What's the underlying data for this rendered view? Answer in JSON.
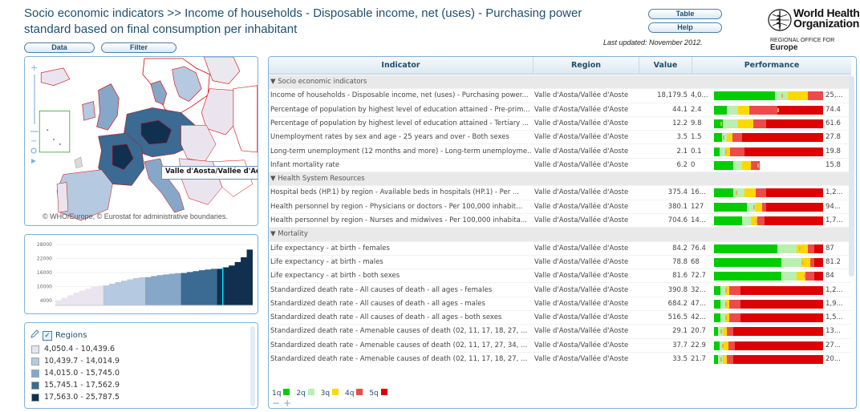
{
  "header": {
    "title": "Socio economic indicators >> Income of households - Disposable income, net (uses) - Purchasing power standard based on final consumption per inhabitant",
    "data_button": "Data",
    "filter_button": "Filter",
    "table_button": "Table",
    "help_button": "Help",
    "last_updated": "Last updated: November 2012."
  },
  "logo": {
    "line1": "World Health",
    "line2": "Organization",
    "regional_small": "REGIONAL OFFICE FOR",
    "regional_big": "Europe"
  },
  "map": {
    "callout": "Valle d'Aosta/Vallée d'Aos",
    "copyright": "© WHO/Europe, © Eurostat for administrative boundaries.",
    "zoom_plus": "+",
    "zoom_minus": "−"
  },
  "chart_data": {
    "type": "area",
    "yticks": [
      4000,
      10000,
      16000,
      22000,
      28000
    ],
    "ylim": [
      2000,
      30000
    ],
    "classes": [
      {
        "range": "4,050.4 - 10,439.6",
        "values": [
          4050,
          5200,
          6300,
          7400,
          8300,
          9100,
          9900,
          10400
        ],
        "color": "#eae4ef"
      },
      {
        "range": "10,439.7 - 14,014.9",
        "values": [
          10500,
          11200,
          11900,
          12500,
          13100,
          13600,
          14000
        ],
        "color": "#b5c9e0"
      },
      {
        "range": "14,015.0 - 15,745.0",
        "values": [
          14050,
          14500,
          14900,
          15200,
          15500,
          15700
        ],
        "color": "#86a7c8"
      },
      {
        "range": "15,745.1 - 17,562.9",
        "values": [
          15800,
          16200,
          16600,
          17000,
          17300,
          17560
        ],
        "color": "#3b6a93"
      },
      {
        "range": "17,563.0 - 25,787.5",
        "values": [
          17600,
          18200,
          19000,
          20500,
          22500,
          25788
        ],
        "color": "#10304f"
      }
    ],
    "highlight_value": 18179.5
  },
  "legend": {
    "title": "Regions",
    "items": [
      {
        "label": "4,050.4 - 10,439.6",
        "color": "#eae4ef"
      },
      {
        "label": "10,439.7 - 14,014.9",
        "color": "#b5c9e0"
      },
      {
        "label": "14,015.0 - 15,745.0",
        "color": "#86a7c8"
      },
      {
        "label": "15,745.1 - 17,562.9",
        "color": "#3b6a93"
      },
      {
        "label": "17,563.0 - 25,787.5",
        "color": "#10304f"
      }
    ]
  },
  "table": {
    "headers": {
      "indicator": "Indicator",
      "region": "Region",
      "value": "Value",
      "performance": "Performance"
    },
    "rows": [
      {
        "group": true,
        "label": "▼ Socio economic indicators"
      },
      {
        "indicator": "Income of households - Disposable income, net (uses) - Purchasing power...",
        "region": "Valle d'Aosta/Vallée d'Aoste",
        "value": "18,179.5",
        "min": "4,0...",
        "max": "25,...",
        "bar": [
          0.56,
          0.68,
          0.86,
          1.0,
          1.0
        ],
        "marker": 0.62
      },
      {
        "indicator": "Percentage of population by highest level of education attained - Pre-prim...",
        "region": "Valle d'Aosta/Vallée d'Aoste",
        "value": "44.1",
        "min": "2.4",
        "max": "74.4",
        "bar": [
          0.12,
          0.22,
          0.32,
          0.58,
          1.0
        ],
        "marker": 0.58
      },
      {
        "indicator": "Percentage of population by highest level of education attained - Tertiary ...",
        "region": "Valle d'Aosta/Vallée d'Aoste",
        "value": "12.2",
        "min": "9.8",
        "max": "61.6",
        "bar": [
          0.08,
          0.22,
          0.36,
          0.48,
          1.0
        ],
        "marker": 0.06
      },
      {
        "indicator": "Unemployment rates by sex and age - 25 years and over - Both sexes",
        "region": "Valle d'Aosta/Vallée d'Aoste",
        "value": "3.5",
        "min": "1.5",
        "max": "27.8",
        "bar": [
          0.07,
          0.12,
          0.17,
          0.26,
          1.0
        ],
        "marker": 0.08
      },
      {
        "indicator": "Long-term unemployment (12 months and more) - Long-term unemployme...",
        "region": "Valle d'Aosta/Vallée d'Aoste",
        "value": "2.1",
        "min": "0.1",
        "max": "19.8",
        "bar": [
          0.05,
          0.1,
          0.15,
          0.28,
          1.0
        ],
        "marker": 0.1
      },
      {
        "indicator": "Infant mortality rate",
        "region": "Valle d'Aosta/Vallée d'Aoste",
        "value": "6.2",
        "min": "0",
        "max": "15.8",
        "bar": [
          0.18,
          0.26,
          0.34,
          0.42,
          0.42
        ],
        "marker": 0.4
      },
      {
        "group": true,
        "label": "▼ Health System Resources"
      },
      {
        "indicator": "Hospital beds (HP.1) by region - Available beds in hospitals (HP.1) - Per ...",
        "region": "Valle d'Aosta/Vallée d'Aoste",
        "value": "375.4",
        "min": "16...",
        "max": "1,2...",
        "bar": [
          0.18,
          0.28,
          0.38,
          0.48,
          1.0
        ],
        "marker": 0.2
      },
      {
        "indicator": "Health personnel by region - Physicians or doctors - Per 100,000 inhabit...",
        "region": "Valle d'Aosta/Vallée d'Aoste",
        "value": "380.1",
        "min": "127",
        "max": "94...",
        "bar": [
          0.3,
          0.38,
          0.44,
          0.48,
          1.0
        ],
        "marker": 0.36
      },
      {
        "indicator": "Health personnel by region - Nurses and midwives - Per 100,000 inhabita...",
        "region": "Valle d'Aosta/Vallée d'Aoste",
        "value": "704.6",
        "min": "14...",
        "max": "1,7...",
        "bar": [
          0.26,
          0.34,
          0.4,
          0.46,
          1.0
        ],
        "marker": 0.38
      },
      {
        "group": true,
        "label": "▼ Mortality"
      },
      {
        "indicator": "Life expectancy - at birth - females",
        "region": "Valle d'Aosta/Vallée d'Aoste",
        "value": "84.2",
        "min": "76.4",
        "max": "87",
        "bar": [
          0.58,
          0.76,
          0.86,
          0.92,
          1.0
        ],
        "marker": 0.78
      },
      {
        "indicator": "Life expectancy - at birth - males",
        "region": "Valle d'Aosta/Vallée d'Aoste",
        "value": "78.8",
        "min": "68",
        "max": "81.2",
        "bar": [
          0.62,
          0.8,
          0.88,
          0.92,
          1.0
        ],
        "marker": 0.8
      },
      {
        "indicator": "Life expectancy - at birth - both sexes",
        "region": "Valle d'Aosta/Vallée d'Aoste",
        "value": "81.6",
        "min": "72.7",
        "max": "84",
        "bar": [
          0.62,
          0.76,
          0.84,
          0.92,
          1.0
        ],
        "marker": 0.82
      },
      {
        "indicator": "Standardized death rate - All causes of death - all ages - females",
        "region": "Valle d'Aosta/Vallée d'Aoste",
        "value": "390.8",
        "min": "32...",
        "max": "1,2...",
        "bar": [
          0.06,
          0.1,
          0.14,
          0.24,
          1.0
        ],
        "marker": 0.1
      },
      {
        "indicator": "Standardized death rate - All causes of death - all ages - males",
        "region": "Valle d'Aosta/Vallée d'Aoste",
        "value": "684.2",
        "min": "47...",
        "max": "1,9...",
        "bar": [
          0.06,
          0.1,
          0.14,
          0.24,
          1.0
        ],
        "marker": 0.1
      },
      {
        "indicator": "Standardized death rate - All causes of death - all ages - both sexes",
        "region": "Valle d'Aosta/Vallée d'Aoste",
        "value": "516.5",
        "min": "42...",
        "max": "1,5...",
        "bar": [
          0.06,
          0.1,
          0.14,
          0.24,
          1.0
        ],
        "marker": 0.1
      },
      {
        "indicator": "Standardized death rate - Amenable causes of death (02, 11, 17, 18, 27, ...",
        "region": "Valle d'Aosta/Vallée d'Aoste",
        "value": "29.1",
        "min": "20.7",
        "max": "13...",
        "bar": [
          0.04,
          0.08,
          0.12,
          0.18,
          1.0
        ],
        "marker": 0.06
      },
      {
        "indicator": "Standardized death rate - Amenable causes of death (02, 11, 17, 27, 34, ...",
        "region": "Valle d'Aosta/Vallée d'Aoste",
        "value": "37.7",
        "min": "22.9",
        "max": "27...",
        "bar": [
          0.05,
          0.09,
          0.13,
          0.19,
          1.0
        ],
        "marker": 0.07
      },
      {
        "indicator": "Standardized death rate - Amenable causes of death (02, 11, 17, 18, 27, ...",
        "region": "Valle d'Aosta/Vallée d'Aoste",
        "value": "33.5",
        "min": "21.7",
        "max": "20...",
        "bar": [
          0.04,
          0.08,
          0.12,
          0.18,
          1.0
        ],
        "marker": 0.06
      }
    ]
  },
  "quintiles": [
    {
      "label": "1q",
      "color": "#00cc00"
    },
    {
      "label": "2q",
      "color": "#b9f0b0"
    },
    {
      "label": "3q",
      "color": "#ffd800"
    },
    {
      "label": "4q",
      "color": "#ee4a4a"
    },
    {
      "label": "5q",
      "color": "#dd0000"
    }
  ],
  "colors": {
    "accent": "#1f4f6e",
    "panel_border": "#7fb2d6",
    "highlight": "#00e5ff"
  }
}
